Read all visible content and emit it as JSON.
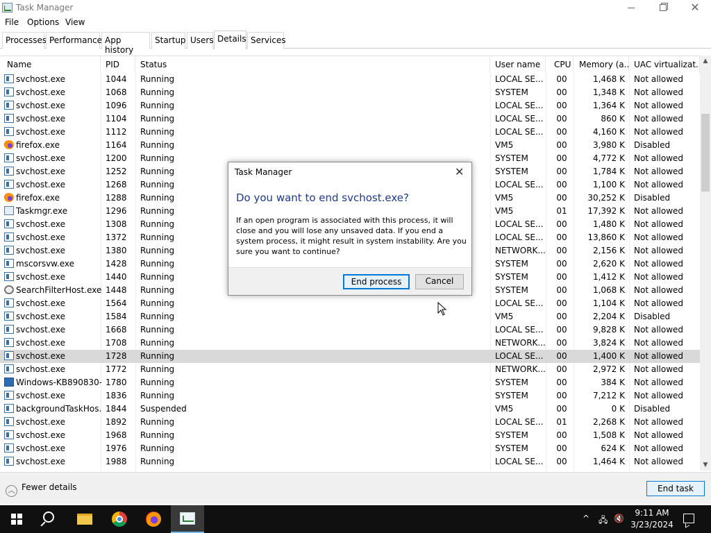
{
  "window": {
    "title": "Task Manager",
    "minimize_label": "",
    "maximize_label": "",
    "close_label": "✕"
  },
  "menu": [
    "File",
    "Options",
    "View"
  ],
  "tabs": [
    "Processes",
    "Performance",
    "App history",
    "Startup",
    "Users",
    "Details",
    "Services"
  ],
  "active_tab": "Details",
  "columns": {
    "name": "Name",
    "pid": "PID",
    "status": "Status",
    "user": "User name",
    "cpu": "CPU",
    "memory": "Memory (a...",
    "uac": "UAC virtualizat..."
  },
  "rows": [
    {
      "icon": "service-icon",
      "name": "svchost.exe",
      "pid": "1044",
      "status": "Running",
      "user": "LOCAL SE...",
      "cpu": "00",
      "memory": "1,468 K",
      "uac": "Not allowed"
    },
    {
      "icon": "service-icon",
      "name": "svchost.exe",
      "pid": "1068",
      "status": "Running",
      "user": "SYSTEM",
      "cpu": "00",
      "memory": "1,348 K",
      "uac": "Not allowed"
    },
    {
      "icon": "service-icon",
      "name": "svchost.exe",
      "pid": "1096",
      "status": "Running",
      "user": "LOCAL SE...",
      "cpu": "00",
      "memory": "1,364 K",
      "uac": "Not allowed"
    },
    {
      "icon": "service-icon",
      "name": "svchost.exe",
      "pid": "1104",
      "status": "Running",
      "user": "LOCAL SE...",
      "cpu": "00",
      "memory": "860 K",
      "uac": "Not allowed"
    },
    {
      "icon": "service-icon",
      "name": "svchost.exe",
      "pid": "1112",
      "status": "Running",
      "user": "LOCAL SE...",
      "cpu": "00",
      "memory": "4,160 K",
      "uac": "Not allowed"
    },
    {
      "icon": "firefox-icon",
      "name": "firefox.exe",
      "pid": "1164",
      "status": "Running",
      "user": "VM5",
      "cpu": "00",
      "memory": "3,980 K",
      "uac": "Disabled"
    },
    {
      "icon": "service-icon",
      "name": "svchost.exe",
      "pid": "1200",
      "status": "Running",
      "user": "SYSTEM",
      "cpu": "00",
      "memory": "4,772 K",
      "uac": "Not allowed"
    },
    {
      "icon": "service-icon",
      "name": "svchost.exe",
      "pid": "1252",
      "status": "Running",
      "user": "SYSTEM",
      "cpu": "00",
      "memory": "1,784 K",
      "uac": "Not allowed"
    },
    {
      "icon": "service-icon",
      "name": "svchost.exe",
      "pid": "1268",
      "status": "Running",
      "user": "LOCAL SE...",
      "cpu": "00",
      "memory": "1,100 K",
      "uac": "Not allowed"
    },
    {
      "icon": "firefox-icon",
      "name": "firefox.exe",
      "pid": "1288",
      "status": "Running",
      "user": "VM5",
      "cpu": "00",
      "memory": "30,252 K",
      "uac": "Disabled"
    },
    {
      "icon": "taskmgr-icon",
      "name": "Taskmgr.exe",
      "pid": "1296",
      "status": "Running",
      "user": "VM5",
      "cpu": "01",
      "memory": "17,392 K",
      "uac": "Not allowed"
    },
    {
      "icon": "service-icon",
      "name": "svchost.exe",
      "pid": "1308",
      "status": "Running",
      "user": "LOCAL SE...",
      "cpu": "00",
      "memory": "1,480 K",
      "uac": "Not allowed"
    },
    {
      "icon": "service-icon",
      "name": "svchost.exe",
      "pid": "1372",
      "status": "Running",
      "user": "LOCAL SE...",
      "cpu": "00",
      "memory": "13,860 K",
      "uac": "Not allowed"
    },
    {
      "icon": "service-icon",
      "name": "svchost.exe",
      "pid": "1380",
      "status": "Running",
      "user": "NETWORK...",
      "cpu": "00",
      "memory": "2,156 K",
      "uac": "Not allowed"
    },
    {
      "icon": "service-icon",
      "name": "mscorsvw.exe",
      "pid": "1428",
      "status": "Running",
      "user": "SYSTEM",
      "cpu": "00",
      "memory": "2,620 K",
      "uac": "Not allowed"
    },
    {
      "icon": "service-icon",
      "name": "svchost.exe",
      "pid": "1440",
      "status": "Running",
      "user": "SYSTEM",
      "cpu": "00",
      "memory": "1,412 K",
      "uac": "Not allowed"
    },
    {
      "icon": "search-filter-icon",
      "name": "SearchFilterHost.exe",
      "pid": "1448",
      "status": "Running",
      "user": "SYSTEM",
      "cpu": "00",
      "memory": "1,068 K",
      "uac": "Not allowed"
    },
    {
      "icon": "service-icon",
      "name": "svchost.exe",
      "pid": "1564",
      "status": "Running",
      "user": "LOCAL SE...",
      "cpu": "00",
      "memory": "1,104 K",
      "uac": "Not allowed"
    },
    {
      "icon": "service-icon",
      "name": "svchost.exe",
      "pid": "1584",
      "status": "Running",
      "user": "VM5",
      "cpu": "00",
      "memory": "2,204 K",
      "uac": "Disabled"
    },
    {
      "icon": "service-icon",
      "name": "svchost.exe",
      "pid": "1668",
      "status": "Running",
      "user": "LOCAL SE...",
      "cpu": "00",
      "memory": "9,828 K",
      "uac": "Not allowed"
    },
    {
      "icon": "service-icon",
      "name": "svchost.exe",
      "pid": "1708",
      "status": "Running",
      "user": "NETWORK...",
      "cpu": "00",
      "memory": "3,824 K",
      "uac": "Not allowed"
    },
    {
      "icon": "service-icon",
      "name": "svchost.exe",
      "pid": "1728",
      "status": "Running",
      "user": "LOCAL SE...",
      "cpu": "00",
      "memory": "1,400 K",
      "uac": "Not allowed",
      "selected": true
    },
    {
      "icon": "service-icon",
      "name": "svchost.exe",
      "pid": "1772",
      "status": "Running",
      "user": "NETWORK...",
      "cpu": "00",
      "memory": "2,972 K",
      "uac": "Not allowed"
    },
    {
      "icon": "windows-update-icon",
      "name": "Windows-KB890830-...",
      "pid": "1780",
      "status": "Running",
      "user": "SYSTEM",
      "cpu": "00",
      "memory": "384 K",
      "uac": "Not allowed"
    },
    {
      "icon": "service-icon",
      "name": "svchost.exe",
      "pid": "1836",
      "status": "Running",
      "user": "SYSTEM",
      "cpu": "00",
      "memory": "7,212 K",
      "uac": "Not allowed"
    },
    {
      "icon": "service-icon",
      "name": "backgroundTaskHos...",
      "pid": "1844",
      "status": "Suspended",
      "user": "VM5",
      "cpu": "00",
      "memory": "0 K",
      "uac": "Disabled"
    },
    {
      "icon": "service-icon",
      "name": "svchost.exe",
      "pid": "1892",
      "status": "Running",
      "user": "LOCAL SE...",
      "cpu": "01",
      "memory": "2,268 K",
      "uac": "Not allowed"
    },
    {
      "icon": "service-icon",
      "name": "svchost.exe",
      "pid": "1968",
      "status": "Running",
      "user": "SYSTEM",
      "cpu": "00",
      "memory": "1,508 K",
      "uac": "Not allowed"
    },
    {
      "icon": "service-icon",
      "name": "svchost.exe",
      "pid": "1976",
      "status": "Running",
      "user": "SYSTEM",
      "cpu": "00",
      "memory": "624 K",
      "uac": "Not allowed"
    },
    {
      "icon": "service-icon",
      "name": "svchost.exe",
      "pid": "1988",
      "status": "Running",
      "user": "LOCAL SE...",
      "cpu": "00",
      "memory": "1,464 K",
      "uac": "Not allowed"
    }
  ],
  "footer": {
    "fewer_details": "Fewer details",
    "end_task": "End task"
  },
  "dialog": {
    "title": "Task Manager",
    "close": "✕",
    "heading": "Do you want to end svchost.exe?",
    "body": "If an open program is associated with this process, it will close and you will lose any unsaved data. If you end a system process, it might result in system instability. Are you sure you want to continue?",
    "end_process": "End process",
    "cancel": "Cancel"
  },
  "taskbar": {
    "apps": [
      "start-icon",
      "search-icon",
      "file-explorer-icon",
      "chrome-icon",
      "firefox-icon",
      "task-manager-icon"
    ],
    "tray": {
      "chevron": "^",
      "network": "🖧",
      "volume": "🔇",
      "time": "9:11 AM",
      "date": "3/23/2024"
    }
  }
}
